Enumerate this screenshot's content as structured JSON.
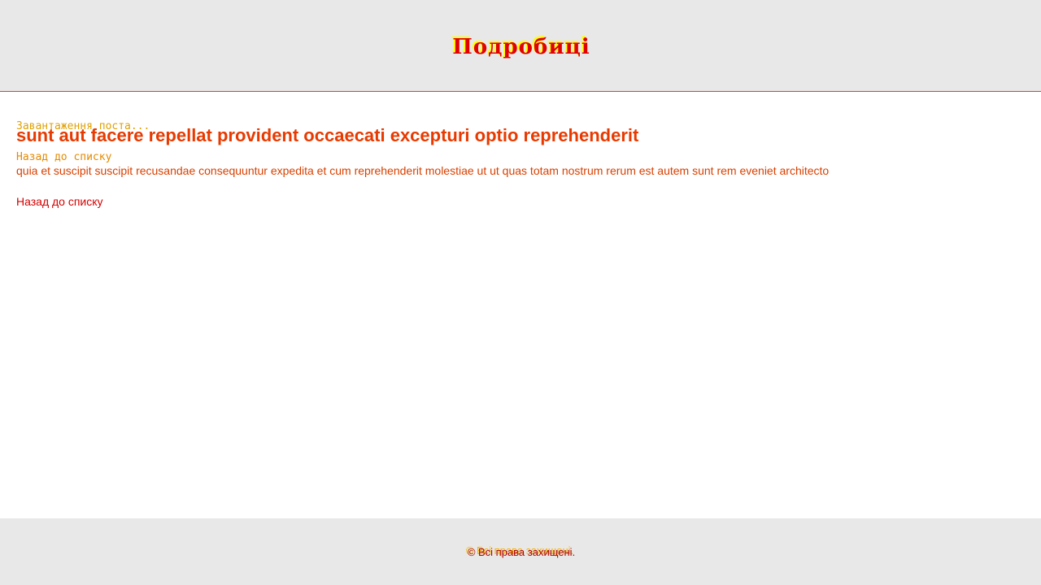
{
  "header": {
    "title": "Подробиці"
  },
  "main": {
    "loading_text": "Завантаження поста...",
    "back_mono_text": "Назад до списку",
    "post": {
      "title": "sunt aut facere repellat provident occaecati excepturi optio reprehenderit",
      "body": "quia et suscipit suscipit recusandae consequuntur expedita et cum reprehenderit molestiae ut ut quas totam nostrum rerum est autem sunt rem eveniet architecto"
    },
    "back_link_label": "Назад до списку"
  },
  "footer": {
    "text": "© Всі права захищені.",
    "text_overlay": "© Всі права захищені."
  },
  "colors": {
    "header_bg": "#e8e8e8",
    "header_border": "#e23a3a",
    "accent_red": "#e00000",
    "accent_yellow": "#ffff00",
    "footer_bg": "#e8e8e8"
  }
}
